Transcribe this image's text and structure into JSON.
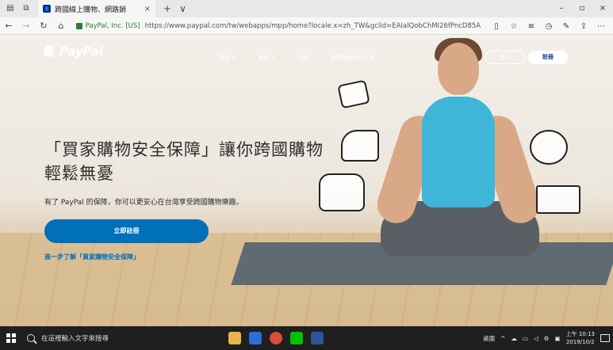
{
  "browser": {
    "tab_title": "跨國線上購物、網路銷",
    "tab_close": "×",
    "new_tab": "+",
    "tab_list": "∨",
    "window_min": "–",
    "window_max": "▫",
    "window_close": "×",
    "cert_label": "PayPal, Inc. [US]",
    "url": "https://www.paypal.com/tw/webapps/mpp/home?locale.x=zh_TW&gclid=EAIaIQobChMI26fPncD85AIVSH"
  },
  "header": {
    "logo_text": "PayPal",
    "nav_items": [
      "購物 ∨",
      "銷售 ∨",
      "付款",
      "商業銷售解決方案"
    ],
    "login_label": "登入",
    "signup_label": "註冊"
  },
  "hero": {
    "title": "「買家購物安全保障」讓你跨國購物輕鬆無憂",
    "subtitle": "有了 PayPal 的保障，你可以更安心在台灣享受跨國購物樂趣。",
    "cta_label": "立即註冊",
    "learn_more": "進一步了解「買家購物安全保障」"
  },
  "taskbar": {
    "search_placeholder": "在這裡輸入文字來搜尋",
    "tray_desktop": "桌面",
    "time": "上午 10:13",
    "date": "2019/10/2"
  },
  "colors": {
    "paypal_blue": "#0070ba",
    "paypal_navy": "#003087",
    "taskbar": "#1f1f1f"
  }
}
